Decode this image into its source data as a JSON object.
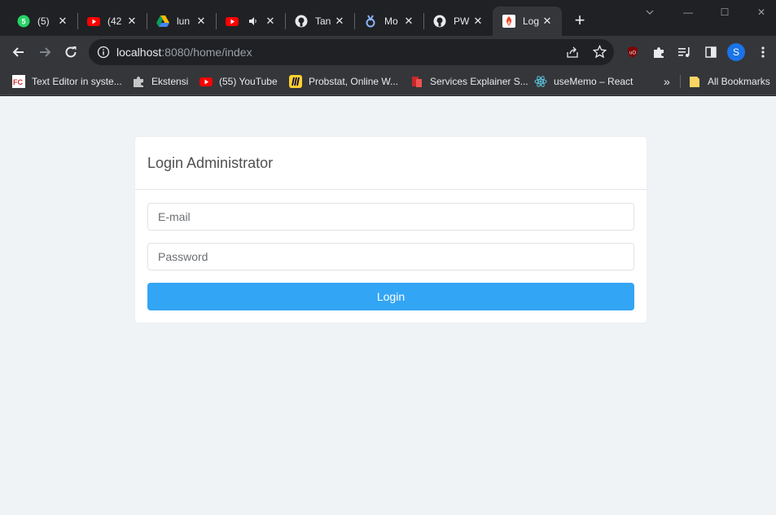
{
  "browser": {
    "tabs": [
      {
        "title": "(5)",
        "icon": "whatsapp-icon"
      },
      {
        "title": "(42",
        "icon": "youtube-icon"
      },
      {
        "title": "lun",
        "icon": "google-drive-icon"
      },
      {
        "title": "",
        "icon": "youtube-icon",
        "audio_icon": "speaker-icon"
      },
      {
        "title": "Tan",
        "icon": "github-icon"
      },
      {
        "title": "Mo",
        "icon": "mo-app-icon"
      },
      {
        "title": "PW",
        "icon": "github-icon"
      },
      {
        "title": "Log",
        "icon": "codeigniter-icon",
        "active": true
      }
    ],
    "close_glyph": "✕",
    "new_tab_glyph": "+",
    "window_controls": {
      "minimize": "—",
      "maximize": "☐",
      "close": "✕"
    },
    "address": {
      "host": "localhost",
      "rest": ":8080/home/index"
    },
    "profile_initial": "S",
    "bookmarks": [
      {
        "label": "Text Editor in syste...",
        "icon": "fc-icon"
      },
      {
        "label": "Ekstensi",
        "icon": "puzzle-icon"
      },
      {
        "label": "(55) YouTube",
        "icon": "youtube-icon"
      },
      {
        "label": "Probstat, Online W...",
        "icon": "miro-icon"
      },
      {
        "label": "Services Explainer S...",
        "icon": "bookmark-red-icon"
      },
      {
        "label": "useMemo – React",
        "icon": "react-icon"
      }
    ],
    "bookmarks_overflow": "»",
    "all_bookmarks": "All Bookmarks",
    "colors": {
      "chrome_dark": "#202124",
      "toolbar": "#35363a",
      "accent": "#1a73e8"
    }
  },
  "login": {
    "title": "Login Administrator",
    "email_placeholder": "E-mail",
    "password_placeholder": "Password",
    "button_label": "Login",
    "colors": {
      "background": "#f0f3f6",
      "button": "#33a5f5"
    }
  }
}
